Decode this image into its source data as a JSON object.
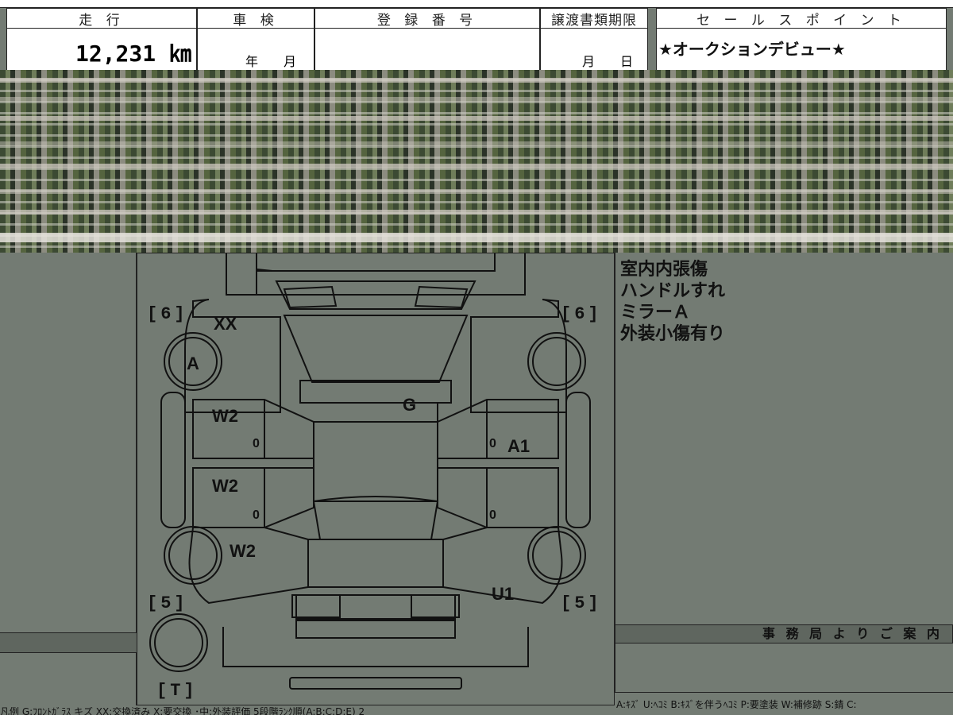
{
  "header": {
    "mileage_label": "走 行",
    "mileage_value": "12,231 ㎞",
    "inspection_label": "車 検",
    "inspection_value": "年　　月",
    "registration_label": "登 録 番 号",
    "registration_value": "",
    "transfer_label": "譲渡書類期限",
    "transfer_value": "月　　日",
    "sales_label": "セ ー ル ス ポ イ ン ト",
    "sales_point": "★オークションデビュー★"
  },
  "notes": [
    "室内内張傷",
    "ハンドルすれ",
    "ミラーＡ",
    "外装小傷有り"
  ],
  "diagram": {
    "tires": {
      "front_left": "6",
      "front_right": "6",
      "rear_left": "5",
      "rear_right": "5",
      "spare": "T"
    },
    "marks": {
      "front_left_fender": "XX",
      "front_left_wheel": "A",
      "front_left_door": "W2",
      "rear_left_door": "W2",
      "rear_left_fender": "W2",
      "hood": "G",
      "front_right_door": "A1",
      "rear_right_fender": "U1"
    },
    "door_zero": "0"
  },
  "office_notice_label": "事 務 局 よ り ご 案 内",
  "footer": {
    "left": "凡例 G:ﾌﾛﾝﾄｶﾞﾗｽ キズ XX:交換済み X:要交換 ･中:外装評価 5段階ﾗﾝｸ順(A:B:C:D:E) 2",
    "right": "A:ｷｽﾞ U:ﾍｺﾐ B:ｷｽﾞを伴うﾍｺﾐ P:要塗装 W:補修跡 S:錆 C:"
  }
}
